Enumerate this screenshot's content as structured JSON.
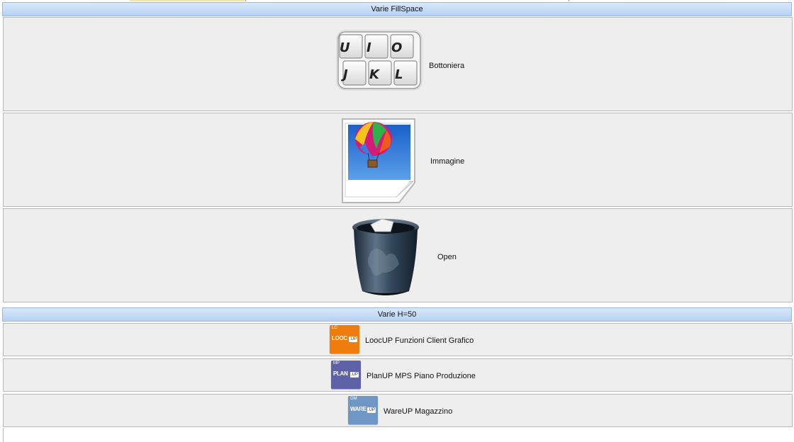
{
  "sections": {
    "fillspace": {
      "title": "Varie FillSpace",
      "rows": [
        {
          "label": "Bottoniera",
          "icon": "keyboard-keys-icon",
          "keys": [
            "U",
            "I",
            "O",
            "J",
            "K",
            "L"
          ]
        },
        {
          "label": "Immagine",
          "icon": "balloon-picture-icon"
        },
        {
          "label": "Open",
          "icon": "trash-bin-icon"
        }
      ]
    },
    "h50": {
      "title": "Varie H=50",
      "rows": [
        {
          "label": "LoocUP Funzioni Client Grafico",
          "icon": "loocup-app-icon",
          "tile_small": "LO",
          "tile_main": "LOOC",
          "tile_badge": ".UP",
          "color": "#ee7d0e"
        },
        {
          "label": "PlanUP MPS Piano Produzione",
          "icon": "planup-app-icon",
          "tile_small": "MP",
          "tile_main": "PLAN",
          "tile_badge": ".UP",
          "color": "#5d61a6"
        },
        {
          "label": "WareUP Magazzino",
          "icon": "wareup-app-icon",
          "tile_small": "GM",
          "tile_main": "WARE",
          "tile_badge": ".UP",
          "color": "#6f97c6"
        }
      ]
    }
  }
}
